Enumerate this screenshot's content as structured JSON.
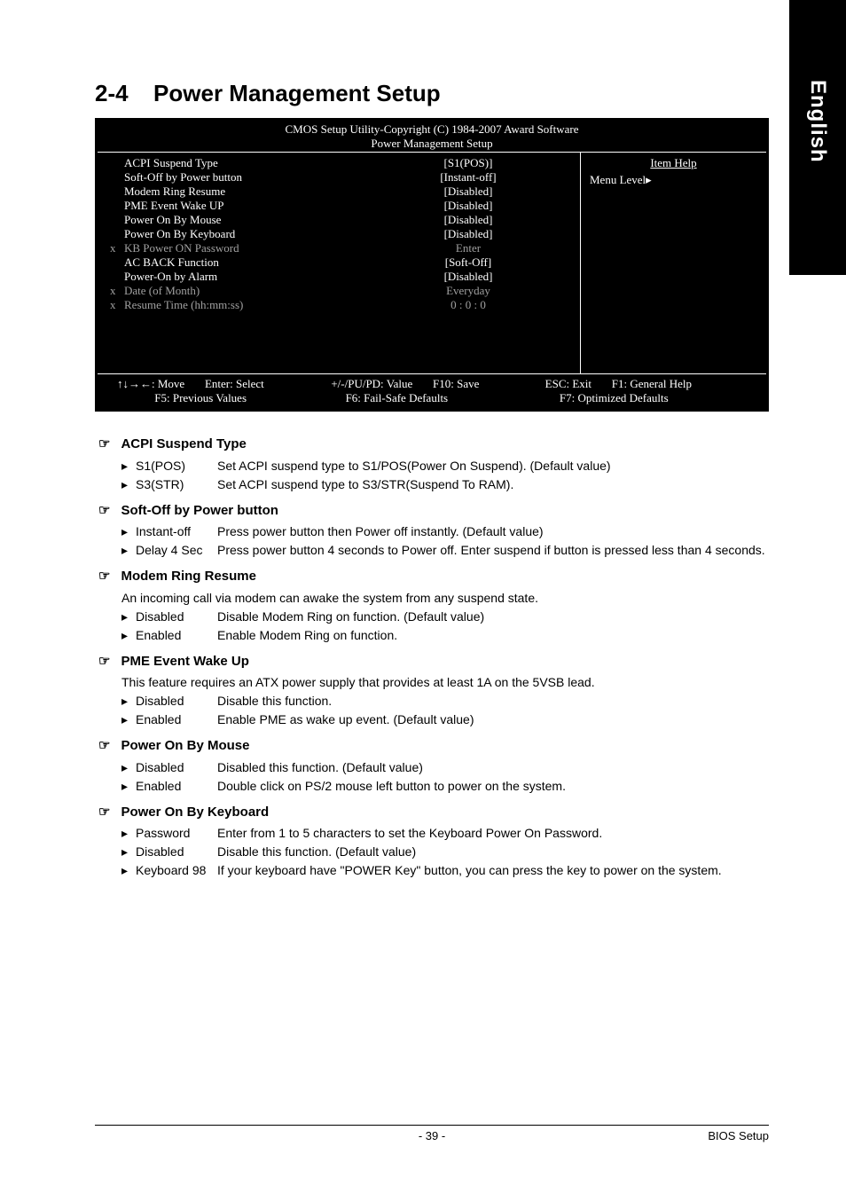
{
  "sideTab": "English",
  "header": {
    "number": "2-4",
    "title": "Power Management Setup"
  },
  "bios": {
    "title1": "CMOS Setup Utility-Copyright (C) 1984-2007 Award Software",
    "title2": "Power Management Setup",
    "rows": [
      {
        "mark": "",
        "label": "ACPI Suspend Type",
        "val": "[S1(POS)]",
        "dis": false
      },
      {
        "mark": "",
        "label": "Soft-Off by Power button",
        "val": "[Instant-off]",
        "dis": false
      },
      {
        "mark": "",
        "label": "Modem Ring Resume",
        "val": "[Disabled]",
        "dis": false
      },
      {
        "mark": "",
        "label": "PME Event Wake UP",
        "val": "[Disabled]",
        "dis": false
      },
      {
        "mark": "",
        "label": "Power On By Mouse",
        "val": "[Disabled]",
        "dis": false
      },
      {
        "mark": "",
        "label": "Power On By Keyboard",
        "val": "[Disabled]",
        "dis": false
      },
      {
        "mark": "x",
        "label": "KB Power ON Password",
        "val": "Enter",
        "dis": true
      },
      {
        "mark": "",
        "label": "AC BACK Function",
        "val": "[Soft-Off]",
        "dis": false
      },
      {
        "mark": "",
        "label": "Power-On by Alarm",
        "val": "[Disabled]",
        "dis": false
      },
      {
        "mark": "x",
        "label": "Date   (of Month)",
        "val": "Everyday",
        "dis": true
      },
      {
        "mark": "x",
        "label": "Resume Time (hh:mm:ss)",
        "val": "0 : 0 : 0",
        "dis": true
      }
    ],
    "help": {
      "title": "Item Help",
      "menu": "Menu Level▸"
    },
    "footer": {
      "c1a": "↑↓→←: Move",
      "c1b": "Enter: Select",
      "c2a": "+/-/PU/PD: Value",
      "c2b": "F10: Save",
      "c3a": "ESC: Exit",
      "c3b": "F1: General Help",
      "r2a": "F5: Previous Values",
      "r2b": "F6: Fail-Safe Defaults",
      "r2c": "F7: Optimized Defaults"
    }
  },
  "sections": [
    {
      "title": "ACPI Suspend Type",
      "options": [
        {
          "label": "S1(POS)",
          "desc": "Set ACPI suspend type to S1/POS(Power On Suspend). (Default value)"
        },
        {
          "label": "S3(STR)",
          "desc": "Set ACPI suspend type to S3/STR(Suspend To RAM)."
        }
      ]
    },
    {
      "title": "Soft-Off by Power button",
      "options": [
        {
          "label": "Instant-off",
          "desc": "Press power button then Power off instantly. (Default value)"
        },
        {
          "label": "Delay 4 Sec",
          "desc": "Press power button 4 seconds to Power off. Enter suspend if button is pressed less than 4 seconds."
        }
      ]
    },
    {
      "title": "Modem Ring Resume",
      "note": "An incoming call via modem can awake the system from any suspend state.",
      "options": [
        {
          "label": "Disabled",
          "desc": "Disable Modem Ring on function. (Default value)"
        },
        {
          "label": "Enabled",
          "desc": "Enable Modem Ring on function."
        }
      ]
    },
    {
      "title": "PME Event Wake Up",
      "note": "This feature requires an ATX power supply that provides at least 1A on the 5VSB lead.",
      "options": [
        {
          "label": "Disabled",
          "desc": "Disable this function."
        },
        {
          "label": "Enabled",
          "desc": "Enable PME as wake up event. (Default value)"
        }
      ]
    },
    {
      "title": "Power On By Mouse",
      "options": [
        {
          "label": "Disabled",
          "desc": "Disabled this function. (Default value)"
        },
        {
          "label": "Enabled",
          "desc": "Double click on PS/2 mouse left button to power on the system."
        }
      ]
    },
    {
      "title": "Power On By Keyboard",
      "options": [
        {
          "label": "Password",
          "desc": "Enter from 1 to 5 characters to set the Keyboard Power On Password."
        },
        {
          "label": "Disabled",
          "desc": "Disable this function. (Default value)"
        },
        {
          "label": "Keyboard 98",
          "desc": "If your keyboard have \"POWER Key\" button, you can press the key to power on the system."
        }
      ]
    }
  ],
  "footer": {
    "page": "- 39 -",
    "right": "BIOS Setup"
  }
}
